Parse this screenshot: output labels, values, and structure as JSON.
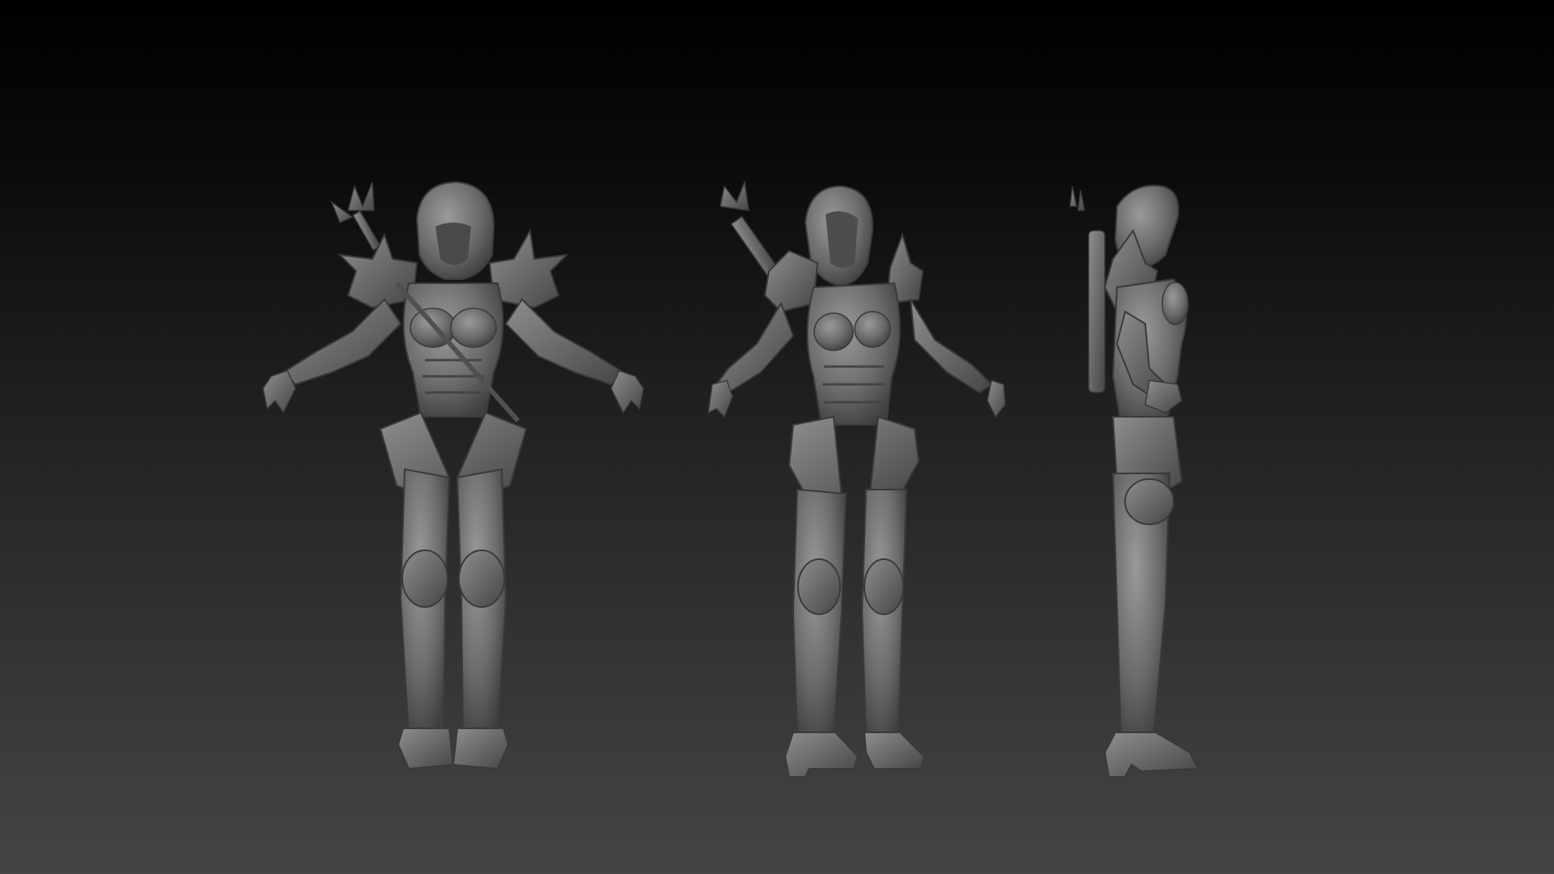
{
  "scene": {
    "background_top": "#000000",
    "background_bottom": "#454545",
    "clay_color": "#6b6b6b",
    "clay_shadow": "#3a3a3a",
    "clay_highlight": "#9a9a9a"
  },
  "figures": [
    {
      "view": "front"
    },
    {
      "view": "three-quarter"
    },
    {
      "view": "side"
    }
  ]
}
